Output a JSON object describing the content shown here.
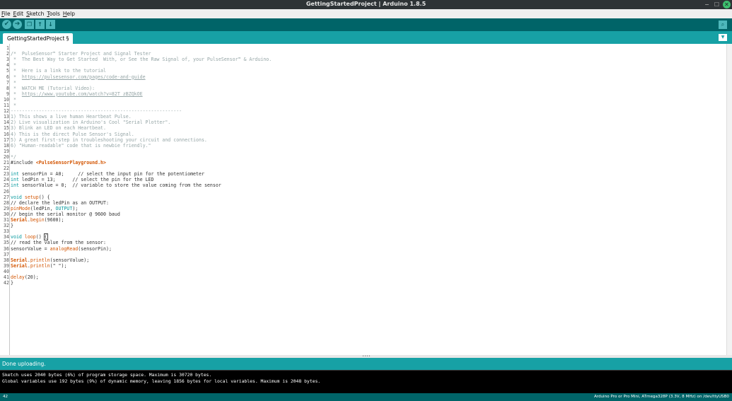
{
  "window": {
    "title": "GettingStartedProject | Arduino 1.8.5",
    "controls": [
      "−",
      "☐",
      "✕"
    ]
  },
  "menu": [
    {
      "label": "File",
      "key": "F",
      "rest": "ile"
    },
    {
      "label": "Edit",
      "key": "E",
      "rest": "dit"
    },
    {
      "label": "Sketch",
      "key": "S",
      "rest": "ketch"
    },
    {
      "label": "Tools",
      "key": "T",
      "rest": "ools"
    },
    {
      "label": "Help",
      "key": "H",
      "rest": "elp"
    }
  ],
  "toolbar": {
    "verify_icon": "checkmark-icon",
    "upload_icon": "right-arrow-icon",
    "new_icon": "new-file-icon",
    "open_icon": "up-arrow-icon",
    "save_icon": "down-arrow-icon",
    "serial_monitor_icon": "magnifier-icon",
    "glyphs": {
      "verify": "✔",
      "upload": "➔",
      "new": "❐",
      "open": "↑",
      "save": "↓",
      "serial": "⌕"
    }
  },
  "tabs": [
    {
      "label": "GettingStartedProject §",
      "active": true
    }
  ],
  "tab_menu_glyph": "▼",
  "colors": {
    "comment": "#95a5a6",
    "keyword": "#00979c",
    "function": "#d35400",
    "constant": "#00979c",
    "include_lib": "#d35400",
    "link": "#95a5a6"
  },
  "editor": {
    "lines": [
      [
        {
          "t": ""
        }
      ],
      [
        {
          "t": "/*  PulseSensor™ Starter Project and Signal Tester",
          "c": "comment"
        }
      ],
      [
        {
          "t": " *  The Best Way to Get Started  With, or See the Raw Signal of, your PulseSensor™ & Arduino.",
          "c": "comment"
        }
      ],
      [
        {
          "t": " *",
          "c": "comment"
        }
      ],
      [
        {
          "t": " *  Here is a link to the tutorial",
          "c": "comment"
        }
      ],
      [
        {
          "t": " *  ",
          "c": "comment"
        },
        {
          "t": "https://pulsesensor.com/pages/code-and-guide",
          "c": "link",
          "u": true
        }
      ],
      [
        {
          "t": " *",
          "c": "comment"
        }
      ],
      [
        {
          "t": " *  WATCH ME (Tutorial Video):",
          "c": "comment"
        }
      ],
      [
        {
          "t": " *  ",
          "c": "comment"
        },
        {
          "t": "https://www.youtube.com/watch?v=82T_zBZQkOE",
          "c": "link",
          "u": true
        }
      ],
      [
        {
          "t": " *",
          "c": "comment"
        }
      ],
      [
        {
          "t": " *",
          "c": "comment"
        }
      ],
      [
        {
          "t": "-------------------------------------------------------------",
          "c": "comment"
        }
      ],
      [
        {
          "t": "1) This shows a live human Heartbeat Pulse.",
          "c": "comment"
        }
      ],
      [
        {
          "t": "2) Live visualization in Arduino's Cool \"Serial Plotter\".",
          "c": "comment"
        }
      ],
      [
        {
          "t": "3) Blink an LED on each Heartbeat.",
          "c": "comment"
        }
      ],
      [
        {
          "t": "4) This is the direct Pulse Sensor's Signal.",
          "c": "comment"
        }
      ],
      [
        {
          "t": "5) A great first-step in troubleshooting your circuit and connections.",
          "c": "comment"
        }
      ],
      [
        {
          "t": "6) \"Human-readable\" code that is newbie friendly.\"",
          "c": "comment"
        }
      ],
      [
        {
          "t": ""
        }
      ],
      [
        {
          "t": "*/",
          "c": "comment"
        }
      ],
      [
        {
          "t": "#include ",
          "c": "plain"
        },
        {
          "t": "<PulseSensorPlayground.h>",
          "c": "include_lib",
          "b": true
        }
      ],
      [
        {
          "t": ""
        }
      ],
      [
        {
          "t": "int",
          "c": "keyword"
        },
        {
          "t": " sensorPin = A0;     ",
          "c": "plain"
        },
        {
          "t": "// select the input pin for the potentiometer",
          "c": "plain"
        }
      ],
      [
        {
          "t": "int",
          "c": "keyword"
        },
        {
          "t": " ledPin = 13;      ",
          "c": "plain"
        },
        {
          "t": "// select the pin for the LED",
          "c": "plain"
        }
      ],
      [
        {
          "t": "int",
          "c": "keyword"
        },
        {
          "t": " sensorValue = 0;  ",
          "c": "plain"
        },
        {
          "t": "// variable to store the value coming from the sensor",
          "c": "plain"
        }
      ],
      [
        {
          "t": ""
        }
      ],
      [
        {
          "t": "void",
          "c": "keyword"
        },
        {
          "t": " ",
          "c": "plain"
        },
        {
          "t": "setup",
          "c": "function"
        },
        {
          "t": "() {",
          "c": "plain"
        }
      ],
      [
        {
          "t": "// declare the ledPin as an OUTPUT:",
          "c": "plain"
        }
      ],
      [
        {
          "t": "pinMode",
          "c": "function"
        },
        {
          "t": "(ledPin, ",
          "c": "plain"
        },
        {
          "t": "OUTPUT",
          "c": "constant"
        },
        {
          "t": ");",
          "c": "plain"
        }
      ],
      [
        {
          "t": "// begin the serial monitor @ 9600 baud",
          "c": "plain"
        }
      ],
      [
        {
          "t": "Serial",
          "c": "function",
          "b": true
        },
        {
          "t": ".",
          "c": "plain"
        },
        {
          "t": "begin",
          "c": "function"
        },
        {
          "t": "(9600);",
          "c": "plain"
        }
      ],
      [
        {
          "t": "}",
          "c": "plain"
        }
      ],
      [
        {
          "t": ""
        }
      ],
      [
        {
          "t": "void",
          "c": "keyword"
        },
        {
          "t": " ",
          "c": "plain"
        },
        {
          "t": "loop",
          "c": "function"
        },
        {
          "t": "() ",
          "c": "plain"
        },
        {
          "t": "{",
          "c": "plain",
          "box": true
        }
      ],
      [
        {
          "t": "// read the value from the sensor:",
          "c": "plain"
        }
      ],
      [
        {
          "t": "sensorValue = ",
          "c": "plain"
        },
        {
          "t": "analogRead",
          "c": "function"
        },
        {
          "t": "(sensorPin);",
          "c": "plain"
        }
      ],
      [
        {
          "t": ""
        }
      ],
      [
        {
          "t": "Serial",
          "c": "function",
          "b": true
        },
        {
          "t": ".",
          "c": "plain"
        },
        {
          "t": "println",
          "c": "function"
        },
        {
          "t": "(sensorValue);",
          "c": "plain"
        }
      ],
      [
        {
          "t": "Serial",
          "c": "function",
          "b": true
        },
        {
          "t": ".",
          "c": "plain"
        },
        {
          "t": "println",
          "c": "function"
        },
        {
          "t": "(\" \");",
          "c": "plain"
        }
      ],
      [
        {
          "t": ""
        }
      ],
      [
        {
          "t": "delay",
          "c": "function"
        },
        {
          "t": "(20);",
          "c": "plain"
        }
      ],
      [
        {
          "t": "}",
          "c": "plain"
        }
      ]
    ]
  },
  "grip": "••••",
  "status": {
    "message": "Done uploading."
  },
  "console": {
    "lines": [
      "Sketch uses 2040 bytes (6%) of program storage space. Maximum is 30720 bytes.",
      "Global variables use 192 bytes (9%) of dynamic memory, leaving 1856 bytes for local variables. Maximum is 2048 bytes."
    ]
  },
  "footer": {
    "line_number": "42",
    "board": "Arduino Pro or Pro Mini, ATmega328P (3.3V, 8 MHz) on /dev/ttyUSB0"
  }
}
